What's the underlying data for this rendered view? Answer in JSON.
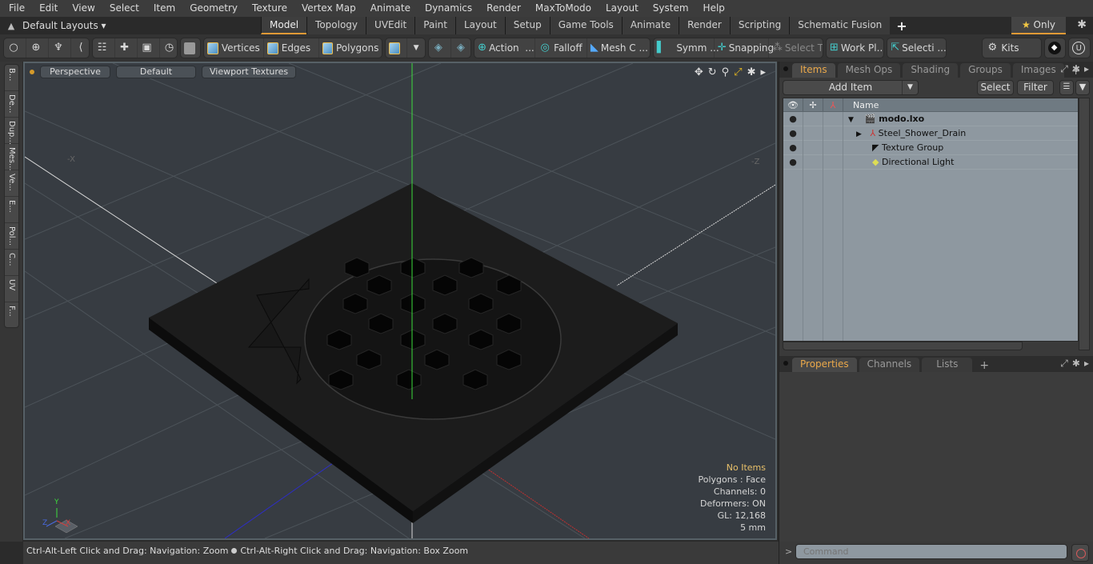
{
  "menu": [
    "File",
    "Edit",
    "View",
    "Select",
    "Item",
    "Geometry",
    "Texture",
    "Vertex Map",
    "Animate",
    "Dynamics",
    "Render",
    "MaxToModo",
    "Layout",
    "System",
    "Help"
  ],
  "layoutbar": {
    "layouts_label": "Default Layouts",
    "tabs": [
      "Model",
      "Topology",
      "UVEdit",
      "Paint",
      "Layout",
      "Setup",
      "Game Tools",
      "Animate",
      "Render",
      "Scripting",
      "Schematic Fusion"
    ],
    "active_tab": "Model",
    "only_label": "Only"
  },
  "toolbar": {
    "vertices": "Vertices",
    "edges": "Edges",
    "polygons": "Polygons",
    "action": "Action",
    "action_more": "...",
    "falloff": "Falloff",
    "mesh_c": "Mesh C ...",
    "symm": "Symm ...",
    "snapping": "Snapping",
    "select_t": "Select T...",
    "work_pl": "Work Pl...",
    "selecti": "Selecti ...",
    "kits": "Kits"
  },
  "left_tabs": [
    "B...",
    "De...",
    "Dup...",
    "Mes...",
    "Ve...",
    "E...",
    "Pol...",
    "C...",
    "UV",
    "F..."
  ],
  "viewport": {
    "view_label": "Perspective",
    "shading_label": "Default",
    "textures_label": "Viewport Textures",
    "axis_neg_x": "-X",
    "axis_neg_z": "-Z",
    "gizmo": {
      "y": "Y",
      "z": "Z",
      "x": "X"
    },
    "stats": {
      "selection": "No Items",
      "polygons": "Polygons : Face",
      "channels": "Channels: 0",
      "deformers": "Deformers: ON",
      "gl": "GL: 12,168",
      "unit": "5 mm"
    },
    "colors": {
      "y_axis": "#3ddc3d",
      "x_axis": "#c83a3a",
      "z_axis": "#3a3ad8",
      "background": "#373c42"
    }
  },
  "status": {
    "hint1": "Ctrl-Alt-Left Click and Drag: Navigation: Zoom",
    "hint2": "Ctrl-Alt-Right Click and Drag: Navigation: Box Zoom"
  },
  "items_panel": {
    "tabs": [
      "Items",
      "Mesh Ops",
      "Shading",
      "Groups",
      "Images"
    ],
    "active_tab": "Items",
    "add_item": "Add Item",
    "select": "Select",
    "filter": "Filter",
    "name_header": "Name",
    "rows": [
      {
        "name": "modo.lxo",
        "icon": "scene-icon",
        "bold": true
      },
      {
        "name": "Steel_Shower_Drain",
        "icon": "mesh-locator-icon",
        "bold": false
      },
      {
        "name": "Texture Group",
        "icon": "texture-group-icon",
        "bold": false
      },
      {
        "name": "Directional Light",
        "icon": "directional-light-icon",
        "bold": false
      }
    ]
  },
  "properties_panel": {
    "tabs": [
      "Properties",
      "Channels",
      "Lists"
    ],
    "active_tab": "Properties"
  },
  "command": {
    "placeholder": "Command",
    "prompt": ">"
  }
}
